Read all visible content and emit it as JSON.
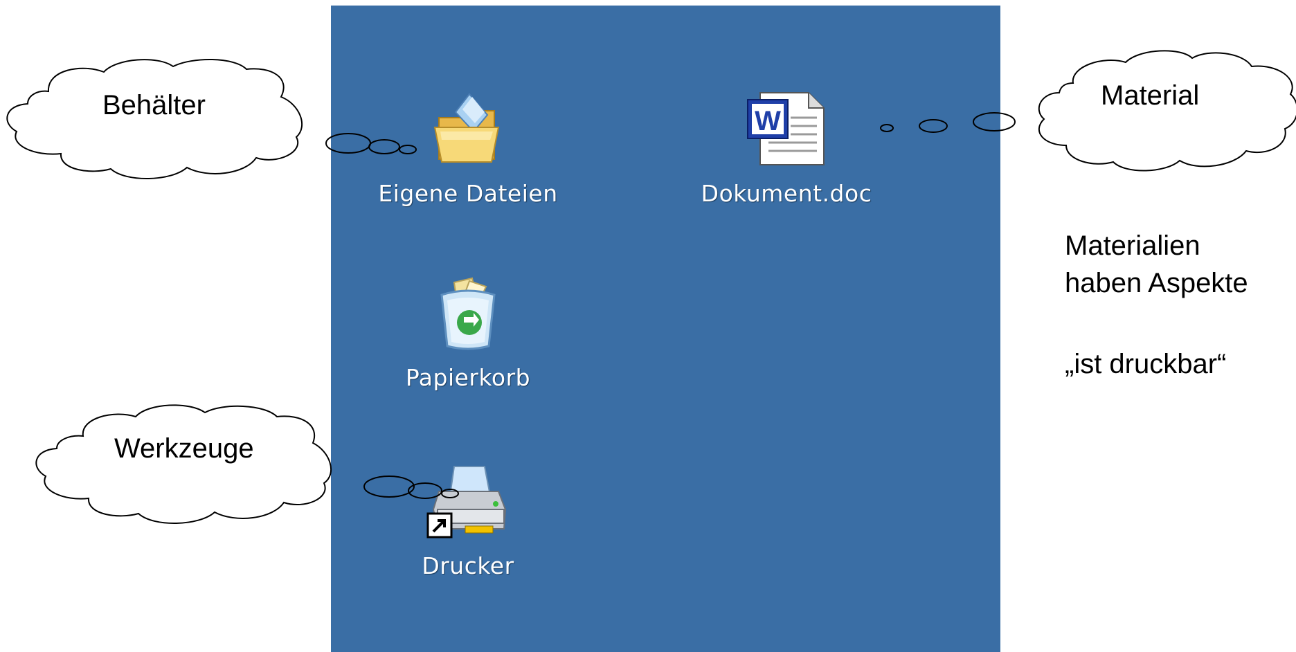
{
  "desktop": {
    "background": "#3a6ea5",
    "icons": [
      {
        "label": "Eigene Dateien",
        "icon": "my-documents-folder-icon"
      },
      {
        "label": "Dokument.doc",
        "icon": "word-document-icon"
      },
      {
        "label": "Papierkorb",
        "icon": "recycle-bin-icon"
      },
      {
        "label": "Drucker",
        "icon": "printer-shortcut-icon"
      }
    ]
  },
  "callouts": {
    "container": "Behälter",
    "material": "Material",
    "tools": "Werkzeuge"
  },
  "notes": {
    "line1": "Materialien",
    "line2": "haben Aspekte",
    "line3": "„ist druckbar“"
  }
}
